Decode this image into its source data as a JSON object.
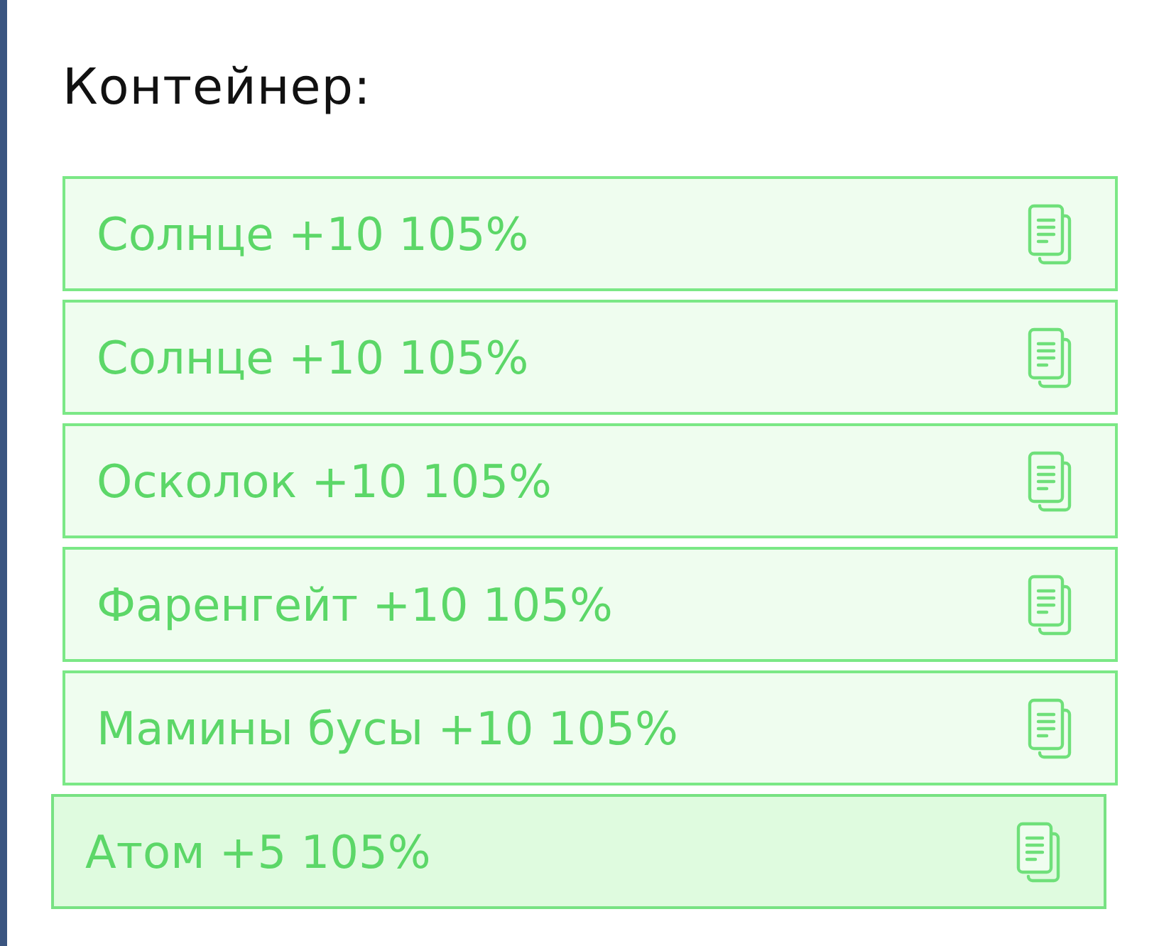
{
  "heading": "Контейнер:",
  "items": [
    {
      "label": "Солнце +10 105%",
      "dragging": false
    },
    {
      "label": "Солнце +10 105%",
      "dragging": false
    },
    {
      "label": "Осколок +10 105%",
      "dragging": false
    },
    {
      "label": "Фаренгейт +10 105%",
      "dragging": false
    },
    {
      "label": "Мамины бусы +10 105%",
      "dragging": false
    },
    {
      "label": "Атом +5 105%",
      "dragging": true
    }
  ]
}
